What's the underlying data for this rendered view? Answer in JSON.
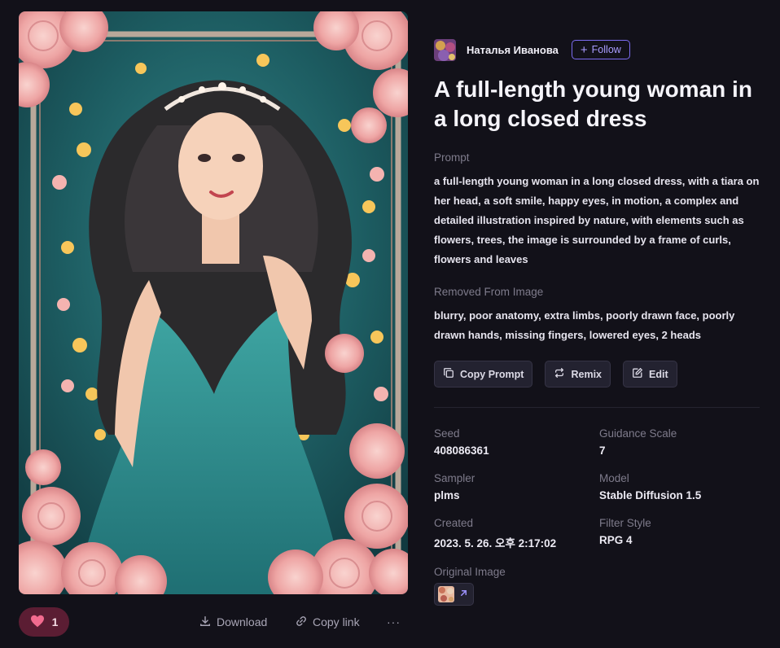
{
  "author": {
    "name": "Наталья Иванова",
    "follow_label": "Follow"
  },
  "title": "A full-length young woman in a long closed dress",
  "prompt": {
    "label": "Prompt",
    "text": "a full-length young woman in a long closed dress, with a tiara on her head, a soft smile, happy eyes, in motion, a complex and detailed illustration inspired by nature, with elements such as flowers, trees, the image is surrounded by a frame of curls, flowers and leaves"
  },
  "removed": {
    "label": "Removed From Image",
    "text": "blurry, poor anatomy, extra limbs, poorly drawn face, poorly drawn hands, missing fingers, lowered eyes, 2 heads"
  },
  "actions": {
    "copy_prompt": "Copy Prompt",
    "remix": "Remix",
    "edit": "Edit"
  },
  "meta": [
    {
      "key": "Seed",
      "value": "408086361"
    },
    {
      "key": "Guidance Scale",
      "value": "7"
    },
    {
      "key": "Sampler",
      "value": "plms"
    },
    {
      "key": "Model",
      "value": "Stable Diffusion 1.5"
    },
    {
      "key": "Created",
      "value": "2023. 5. 26. 오후 2:17:02"
    },
    {
      "key": "Filter Style",
      "value": "RPG 4"
    }
  ],
  "original_image": {
    "label": "Original Image"
  },
  "bottom": {
    "like_count": "1",
    "download_label": "Download",
    "copy_link_label": "Copy link",
    "more_label": "···"
  },
  "colors": {
    "background": "#121119",
    "accent": "#7c6cf0",
    "like_bg": "#5b1d33",
    "heart": "#f26b8f",
    "muted_text": "#7e7b8b"
  },
  "icons": {
    "like": "heart-icon",
    "download": "download-icon",
    "copy_link": "link-icon",
    "more": "more-icon",
    "copy_prompt": "copy-icon",
    "remix": "repeat-icon",
    "edit": "edit-icon",
    "original": "arrow-up-right-icon"
  }
}
